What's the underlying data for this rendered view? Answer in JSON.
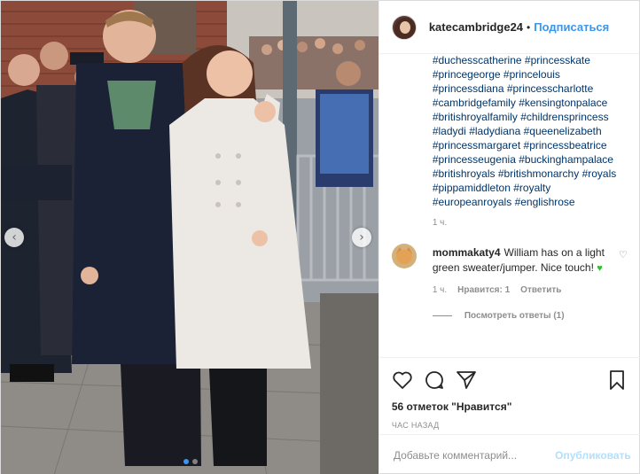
{
  "post": {
    "username": "katecambridge24",
    "separator": "•",
    "follow_label": "Подписаться",
    "more_label": "•••"
  },
  "caption": {
    "hashtags": [
      "#duchesscatherine",
      "#princesskate",
      "#princegeorge",
      "#princelouis",
      "#princessdiana",
      "#princesscharlotte",
      "#cambridgefamily",
      "#kensingtonpalace",
      "#britishroyalfamily",
      "#childrensprincess",
      "#ladydi",
      "#ladydiana",
      "#queenelizabeth",
      "#princessmargaret",
      "#princessbeatrice",
      "#princesseugenia",
      "#buckinghampalace",
      "#britishroyals",
      "#britishmonarchy",
      "#royals",
      "#pippamiddleton",
      "#royalty",
      "#europeanroyals",
      "#englishrose"
    ],
    "time": "1 ч."
  },
  "comment": {
    "user": "mommakaty4",
    "text": "William has on a light green sweater/jumper. Nice touch!",
    "emoji": "♥",
    "time": "1 ч.",
    "likes_label": "Нравится: 1",
    "reply_label": "Ответить",
    "like_icon": "♡",
    "view_replies": "Посмотреть ответы (1)"
  },
  "actions": {
    "likes_text": "56 отметок \"Нравится\"",
    "ago": "ЧАС НАЗАД"
  },
  "add_comment": {
    "placeholder": "Добавьте комментарий...",
    "publish_label": "Опубликовать"
  },
  "carousel": {
    "prev_icon": "‹",
    "next_icon": "›",
    "slide_count": 2,
    "active_slide": 1
  },
  "colors": {
    "link": "#003569",
    "accent": "#3897f0",
    "muted": "#8e8e8e",
    "publish_disabled": "#b2dffc"
  }
}
